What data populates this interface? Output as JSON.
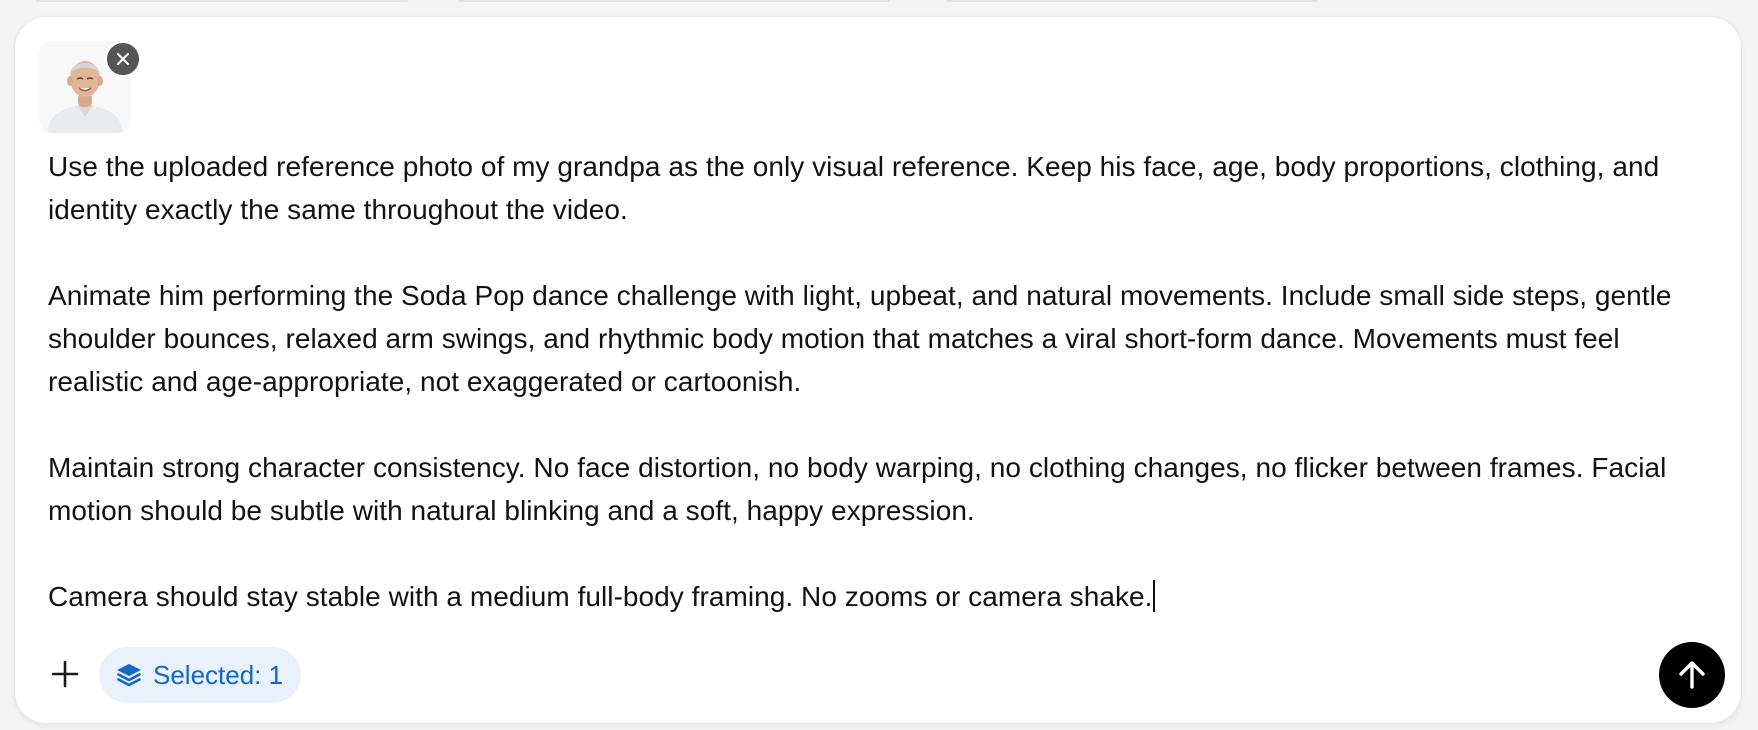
{
  "attachment": {
    "alt": "reference photo of grandpa",
    "remove_icon": "close-icon"
  },
  "prompt": {
    "text": "Use the uploaded reference photo of my grandpa as the only visual reference. Keep his face, age, body proportions, clothing, and identity exactly the same throughout the video.\n\nAnimate him performing the Soda Pop dance challenge with light, upbeat, and natural movements. Include small side steps, gentle shoulder bounces, relaxed arm swings, and rhythmic body motion that matches a viral short-form dance. Movements must feel realistic and age-appropriate, not exaggerated or cartoonish.\n\nMaintain strong character consistency. No face distortion, no body warping, no clothing changes, no flicker between frames. Facial motion should be subtle with natural blinking and a soft, happy expression.\n\nCamera should stay stable with a medium full-body framing. No zooms or camera shake."
  },
  "toolbar": {
    "add_icon": "plus-icon",
    "selected_label": "Selected: 1",
    "selected_icon": "layers-icon",
    "send_icon": "arrow-up-icon"
  },
  "colors": {
    "chip_bg": "#e9f2fc",
    "chip_text": "#1467c8",
    "send_bg": "#000000",
    "remove_bg": "#555558"
  }
}
